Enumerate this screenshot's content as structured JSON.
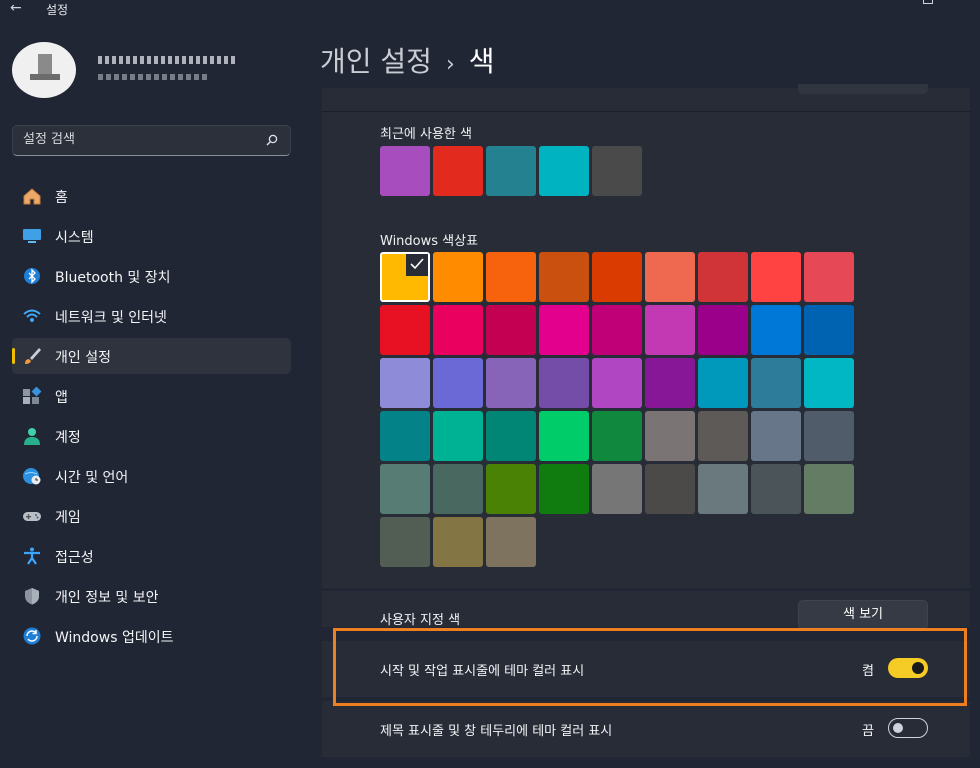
{
  "app": {
    "title": "설정",
    "back_label": "←"
  },
  "search": {
    "placeholder": "설정 검색"
  },
  "sidebar": {
    "items": [
      {
        "label": "홈",
        "icon": "home-icon",
        "active": false
      },
      {
        "label": "시스템",
        "icon": "monitor-icon",
        "active": false
      },
      {
        "label": "Bluetooth 및 장치",
        "icon": "bluetooth-icon",
        "active": false
      },
      {
        "label": "네트워크 및 인터넷",
        "icon": "wifi-icon",
        "active": false
      },
      {
        "label": "개인 설정",
        "icon": "brush-icon",
        "active": true
      },
      {
        "label": "앱",
        "icon": "apps-icon",
        "active": false
      },
      {
        "label": "계정",
        "icon": "account-icon",
        "active": false
      },
      {
        "label": "시간 및 언어",
        "icon": "globe-clock-icon",
        "active": false
      },
      {
        "label": "게임",
        "icon": "gamepad-icon",
        "active": false
      },
      {
        "label": "접근성",
        "icon": "accessibility-icon",
        "active": false
      },
      {
        "label": "개인 정보 및 보안",
        "icon": "shield-icon",
        "active": false
      },
      {
        "label": "Windows 업데이트",
        "icon": "update-icon",
        "active": false
      }
    ]
  },
  "header": {
    "crumb": "개인 설정",
    "separator": "›",
    "title": "색"
  },
  "colors": {
    "recent_label": "최근에 사용한 색",
    "recent": [
      "#a84dbe",
      "#e22b1e",
      "#24818f",
      "#00b3c1",
      "#4a4a4a"
    ],
    "palette_label": "Windows 색상표",
    "palette": [
      [
        "#ffb900",
        "#ff8c00",
        "#f7630c",
        "#ca5010",
        "#da3b01",
        "#ef6950",
        "#d13438",
        "#ff4343",
        "#e74856"
      ],
      [
        "#e81123",
        "#ea005e",
        "#c30052",
        "#e3008c",
        "#bf0077",
        "#c239b3",
        "#9a0089",
        "#0078d7",
        "#0063b1"
      ],
      [
        "#8e8cd8",
        "#6b69d6",
        "#8764b8",
        "#744da9",
        "#b146c2",
        "#881798",
        "#0099bc",
        "#2d7d9a",
        "#00b7c3"
      ],
      [
        "#038387",
        "#00b294",
        "#018574",
        "#00cc6a",
        "#10893e",
        "#7a7574",
        "#5d5a58",
        "#68768a",
        "#515c6b"
      ],
      [
        "#567c73",
        "#486860",
        "#498205",
        "#107c10",
        "#767676",
        "#4c4a48",
        "#69797e",
        "#4a5459",
        "#647c64"
      ],
      [
        "#525e54",
        "#847545",
        "#7e735f"
      ]
    ],
    "selected": "#ffb900",
    "custom_label": "사용자 지정 색",
    "custom_button": "색 보기"
  },
  "settings": {
    "taskbar_accent": {
      "label": "시작 및 작업 표시줄에 테마 컬러 표시",
      "state": "켬",
      "on": true
    },
    "titlebar_accent": {
      "label": "제목 표시줄 및 창 테두리에 테마 컬러 표시",
      "state": "끔",
      "on": false
    }
  },
  "accent": {
    "toggle_on": "#f5cb26",
    "highlight": "#f07f22",
    "active_indicator": "#f0c000"
  }
}
